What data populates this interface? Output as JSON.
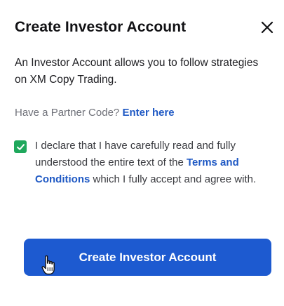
{
  "dialog": {
    "title": "Create Investor Account",
    "close_icon": "close-icon",
    "intro": "An Investor Account allows you to follow strategies on XM Copy Trading.",
    "partner": {
      "prompt": "Have a Partner Code?",
      "link_label": "Enter here"
    },
    "declaration": {
      "checked": true,
      "text_before": "I declare that I have carefully read and fully understood the entire text of the",
      "link_label": "Terms and Conditions",
      "text_after": "which I fully accept and agree with."
    },
    "submit_label": "Create Investor Account"
  },
  "colors": {
    "accent_blue": "#1d5ad0",
    "link_blue": "#1f59c4",
    "checkbox_green": "#1fa85c"
  }
}
